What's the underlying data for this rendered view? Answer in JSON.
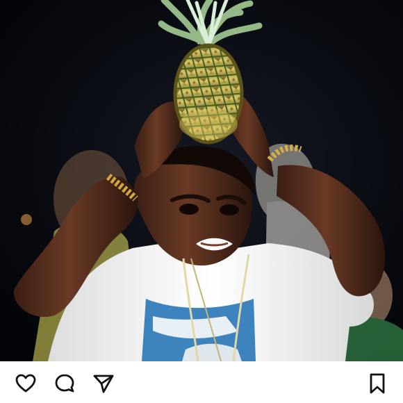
{
  "post": {
    "photo_subject": "",
    "photo_text": "",
    "icons": {
      "like": "heart-icon",
      "comment": "comment-icon",
      "share": "paper-plane-icon",
      "save": "bookmark-icon"
    },
    "colors": {
      "action_icon": "#111111",
      "background": "#ffffff",
      "photo_background": "#05060d"
    }
  }
}
